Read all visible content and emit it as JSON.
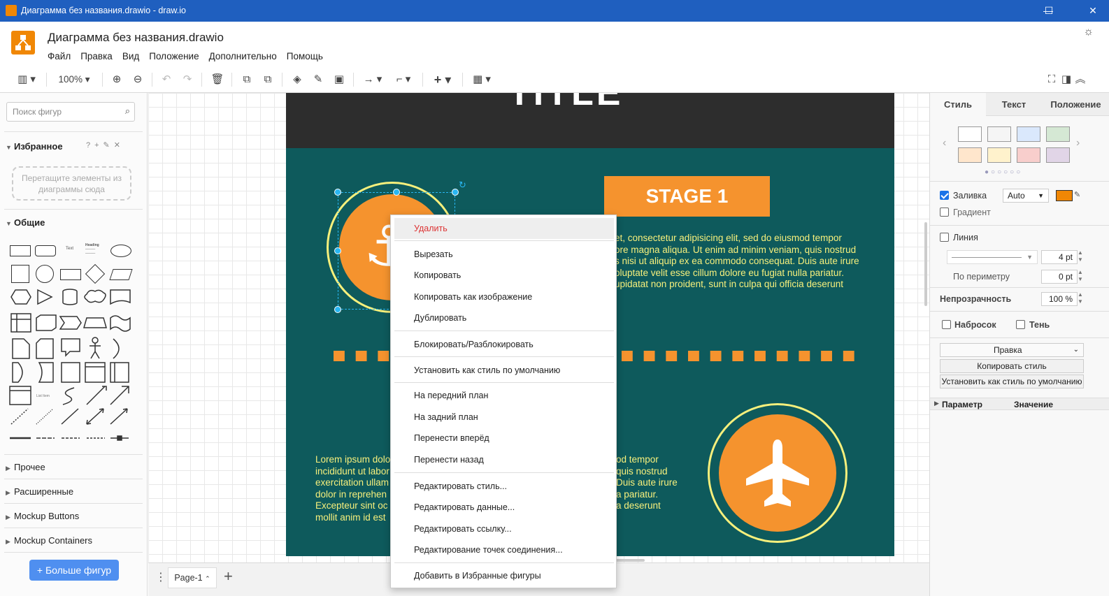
{
  "window": {
    "title": "Диаграмма без названия.drawio - draw.io",
    "minimize": "—",
    "maximize": "☐",
    "close": "✕"
  },
  "app": {
    "doc_title": "Диаграмма без названия.drawio",
    "menu": [
      "Файл",
      "Правка",
      "Вид",
      "Положение",
      "Дополнительно",
      "Помощь"
    ]
  },
  "toolbar": {
    "zoom": "100%"
  },
  "sidebar": {
    "search_placeholder": "Поиск фигур",
    "favorites_title": "Избранное",
    "favorites_drop": "Перетащите элементы из диаграммы сюда",
    "general_title": "Общие",
    "sections": [
      "Прочее",
      "Расширенные",
      "Mockup Buttons",
      "Mockup Containers"
    ],
    "more_shapes": "+ Больше фигур",
    "mini_text": "Text",
    "mini_heading": "Heading",
    "mini_list": "List Item"
  },
  "canvas": {
    "title_fragment": "TITLE",
    "stage_label": "STAGE 1",
    "lorem_right": [
      "et, consectetur adipisicing elit, sed do eiusmod tempor",
      "ore magna aliqua. Ut enim ad minim veniam, quis nostrud",
      "s nisi ut aliquip ex ea commodo consequat. Duis aute irure",
      "oluptate velit esse cillum dolore eu fugiat nulla pariatur.",
      "upidatat non proident, sunt in culpa qui officia deserunt"
    ],
    "lorem_left": [
      "Lorem ipsum dolo",
      "incididunt ut labor",
      "exercitation ullam",
      "dolor in reprehen",
      "Excepteur sint oc",
      "mollit anim id est"
    ],
    "lorem_mid": [
      "od tempor",
      "quis nostrud",
      "Duis aute irure",
      "a pariatur.",
      "a deserunt"
    ],
    "colors": {
      "dark": "#2d2d2d",
      "teal": "#0e5a5c",
      "orange": "#f5932e",
      "yellow": "#f7f07c"
    }
  },
  "pagebar": {
    "page_tab": "Page-1",
    "add": "+"
  },
  "rightpanel": {
    "tabs": [
      "Стиль",
      "Текст",
      "Положение"
    ],
    "fill_label": "Заливка",
    "fill_mode": "Auto",
    "fill_color": "#f08705",
    "gradient_label": "Градиент",
    "line_label": "Линия",
    "line_width": "4 pt",
    "perimeter_label": "По периметру",
    "perimeter_value": "0 pt",
    "opacity_label": "Непрозрачность",
    "opacity_value": "100 %",
    "sketch_label": "Набросок",
    "shadow_label": "Тень",
    "edit_select": "Правка",
    "copy_style": "Копировать стиль",
    "set_default": "Установить как стиль по умолчанию",
    "prop_col": "Параметр",
    "value_col": "Значение",
    "swatches": [
      "#ffffff",
      "#f5f5f5",
      "#dae8fc",
      "#d5e8d4",
      "#ffe6cc",
      "#fff2cc",
      "#f8cecc",
      "#e1d5e7"
    ]
  },
  "context_menu": {
    "items": [
      "Удалить",
      "Вырезать",
      "Копировать",
      "Копировать как изображение",
      "Дублировать",
      "Блокировать/Разблокировать",
      "Установить как стиль по умолчанию",
      "На передний план",
      "На задний план",
      "Перенести вперёд",
      "Перенести назад",
      "Редактировать стиль...",
      "Редактировать данные...",
      "Редактировать ссылку...",
      "Редактирование точек соединения...",
      "Добавить в Избранные фигуры"
    ]
  }
}
